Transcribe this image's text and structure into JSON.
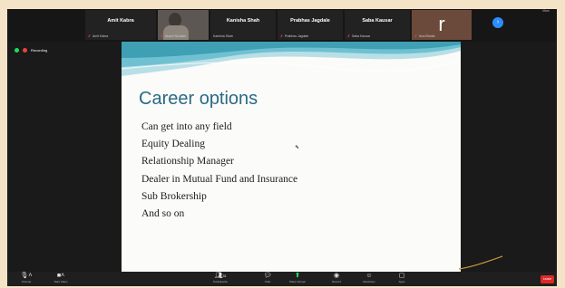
{
  "participants": [
    {
      "name": "Amit Kabra",
      "label": "Amit Kabra",
      "muted": true
    },
    {
      "name": "",
      "label": "Akash Nichlani",
      "muted": true
    },
    {
      "name": "Kanisha Shah",
      "label": "Kanisha Shah",
      "muted": false
    },
    {
      "name": "Prabhas Jagdale",
      "label": "Prabhas Jagdale",
      "muted": true
    },
    {
      "name": "Saba Kausar",
      "label": "Saba Kausar",
      "muted": true
    },
    {
      "name": "r",
      "label": "Isha Bhatia",
      "muted": true
    }
  ],
  "header": {
    "view_label": "View",
    "next_page_icon": "arrow-right"
  },
  "recording": {
    "label": "Recording"
  },
  "slide": {
    "title": "Career options",
    "bullets": [
      "Can get into any field",
      "Equity Dealing",
      "Relationship Manager",
      "Dealer in Mutual Fund and Insurance",
      "Sub Brokership",
      "And so on"
    ]
  },
  "toolbar": {
    "mute": "Unmute",
    "video": "Start Video",
    "participants": "Participants",
    "participants_count": "33",
    "chat": "Chat",
    "share": "Share Screen",
    "record": "Record",
    "reactions": "Reactions",
    "apps": "Apps",
    "leave": "Leave"
  },
  "colors": {
    "accent": "#2d8cff",
    "share": "#23d95e",
    "leave": "#e02828",
    "title": "#2a6a85"
  }
}
